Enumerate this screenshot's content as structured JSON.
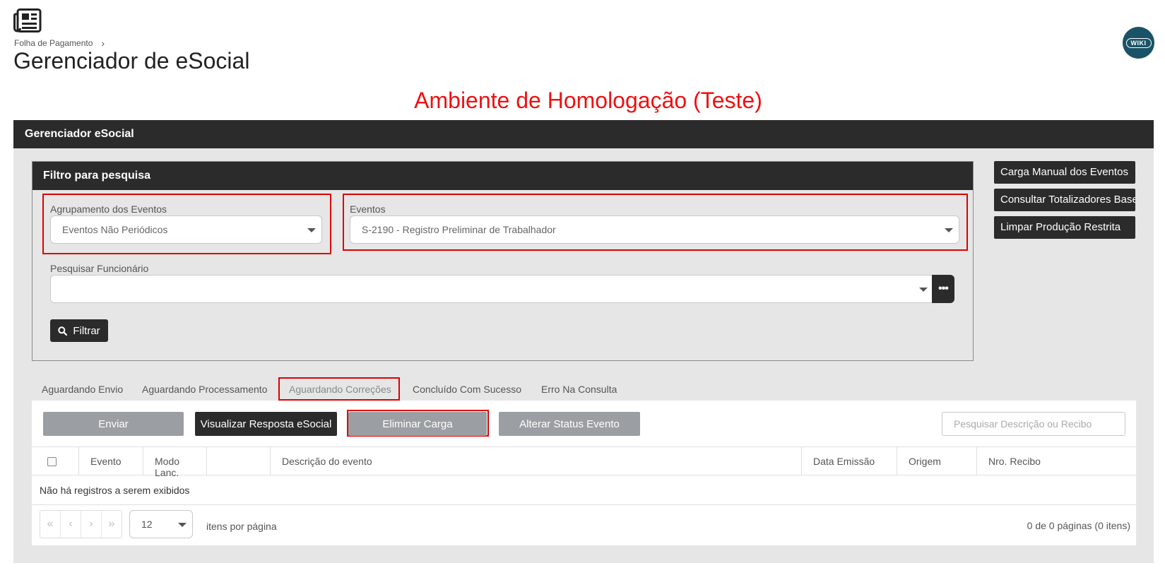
{
  "header": {
    "breadcrumb": "Folha de Pagamento",
    "title": "Gerenciador de eSocial",
    "wiki_label": "WIKI"
  },
  "env_banner": "Ambiente de Homologação (Teste)",
  "panel": {
    "title": "Gerenciador eSocial"
  },
  "filter": {
    "title": "Filtro para pesquisa",
    "group_label": "Agrupamento dos Eventos",
    "group_value": "Eventos Não Periódicos",
    "events_label": "Eventos",
    "events_value": "S-2190 - Registro Preliminar de Trabalhador",
    "employee_label": "Pesquisar Funcionário",
    "employee_value": "",
    "ellipsis": "•••",
    "filter_button": "Filtrar"
  },
  "side_buttons": [
    "Carga Manual dos Eventos",
    "Consultar Totalizadores Base",
    "Limpar Produção Restrita"
  ],
  "tabs": [
    "Aguardando Envio",
    "Aguardando Processamento",
    "Aguardando Correções",
    "Concluído Com Sucesso",
    "Erro Na Consulta"
  ],
  "actions": {
    "send": "Enviar",
    "view_response": "Visualizar Resposta eSocial",
    "remove_load": "Eliminar Carga",
    "change_status": "Alterar Status Evento",
    "search_placeholder": "Pesquisar Descrição ou Recibo"
  },
  "grid": {
    "columns": [
      "Evento",
      "Modo Lanc.",
      "",
      "Descrição do evento",
      "Data Emissão",
      "Origem",
      "Nro. Recibo"
    ],
    "empty_message": "Não há registros a serem exibidos"
  },
  "pager": {
    "first": "«",
    "prev": "‹",
    "next": "›",
    "last": "»",
    "page_size": "12",
    "per_page_label": "itens por página",
    "info": "0 de 0 páginas (0 itens)"
  },
  "colors": {
    "dark": "#2b2b2b",
    "gray_button": "#9b9fa3",
    "highlight_red": "#e00000",
    "banner_red": "#ee1111",
    "wiki_teal": "#1a5367"
  }
}
